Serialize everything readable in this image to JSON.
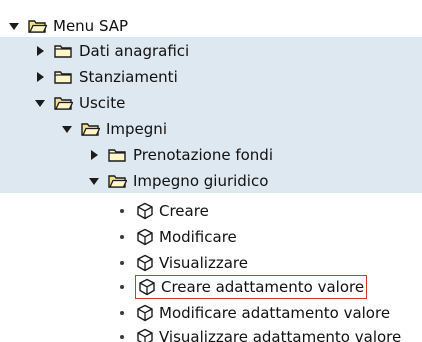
{
  "tree": {
    "root": {
      "label": "Menu SAP",
      "icon": "folder-open-icon",
      "expanded": true
    },
    "dati": {
      "label": "Dati anagrafici",
      "icon": "folder-closed-icon",
      "expanded": false
    },
    "stanziamenti": {
      "label": "Stanziamenti",
      "icon": "folder-closed-icon",
      "expanded": false
    },
    "uscite": {
      "label": "Uscite",
      "icon": "folder-open-icon",
      "expanded": true
    },
    "impegni": {
      "label": "Impegni",
      "icon": "folder-open-icon",
      "expanded": true
    },
    "prenotazione": {
      "label": "Prenotazione fondi",
      "icon": "folder-closed-icon",
      "expanded": false
    },
    "impegno_giuridico": {
      "label": "Impegno giuridico",
      "icon": "folder-open-icon",
      "expanded": true
    },
    "transactions": [
      {
        "label": "Creare",
        "icon": "transaction-cube-icon",
        "selected": false
      },
      {
        "label": "Modificare",
        "icon": "transaction-cube-icon",
        "selected": false
      },
      {
        "label": "Visualizzare",
        "icon": "transaction-cube-icon",
        "selected": false
      },
      {
        "label": "Creare adattamento valore",
        "icon": "transaction-cube-icon",
        "selected": true
      },
      {
        "label": "Modificare adattamento valore",
        "icon": "transaction-cube-icon",
        "selected": false
      },
      {
        "label": "Visualizzare adattamento valore",
        "icon": "transaction-cube-icon",
        "selected": false
      }
    ]
  },
  "colors": {
    "band": "#dde8f1",
    "selection_border": "#d9362b",
    "folder_fill": "#f6e08a",
    "folder_stroke": "#1c1c1c"
  }
}
